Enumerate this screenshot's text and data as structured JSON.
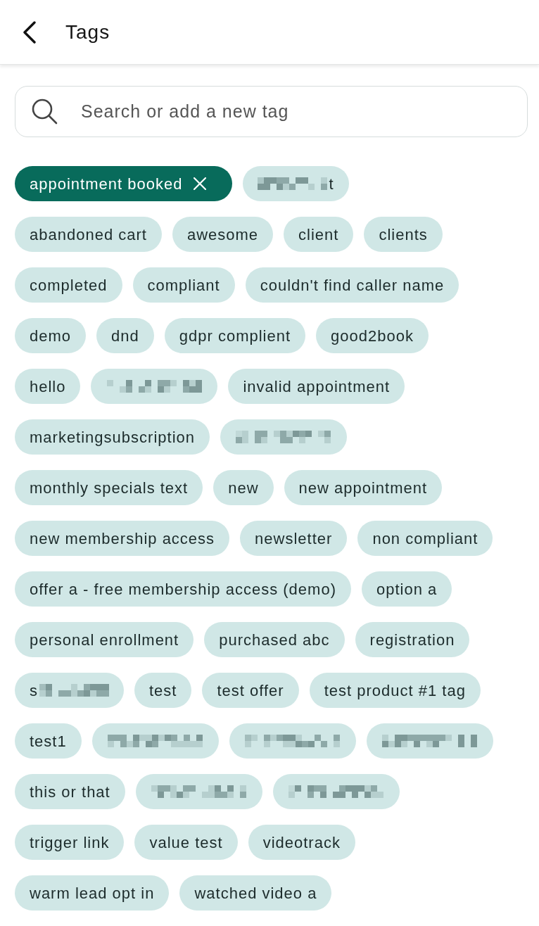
{
  "header": {
    "title": "Tags"
  },
  "search": {
    "placeholder": "Search or add a new tag"
  },
  "tags": [
    {
      "kind": "tag",
      "label": "appointment booked",
      "selected": true
    },
    {
      "kind": "redacted",
      "tail": "t",
      "selected": false
    },
    {
      "kind": "tag",
      "label": "abandoned cart",
      "selected": false
    },
    {
      "kind": "tag",
      "label": "awesome",
      "selected": false
    },
    {
      "kind": "tag",
      "label": "client",
      "selected": false
    },
    {
      "kind": "tag",
      "label": "clients",
      "selected": false
    },
    {
      "kind": "tag",
      "label": "completed",
      "selected": false
    },
    {
      "kind": "tag",
      "label": "compliant",
      "selected": false
    },
    {
      "kind": "tag",
      "label": "couldn't find caller name",
      "selected": false
    },
    {
      "kind": "tag",
      "label": "demo",
      "selected": false
    },
    {
      "kind": "tag",
      "label": "dnd",
      "selected": false
    },
    {
      "kind": "tag",
      "label": "gdpr complient",
      "selected": false
    },
    {
      "kind": "tag",
      "label": "good2book",
      "selected": false
    },
    {
      "kind": "tag",
      "label": "hello",
      "selected": false
    },
    {
      "kind": "redacted",
      "selected": false
    },
    {
      "kind": "tag",
      "label": "invalid appointment",
      "selected": false
    },
    {
      "kind": "tag",
      "label": "marketingsubscription",
      "selected": false
    },
    {
      "kind": "redacted",
      "selected": false
    },
    {
      "kind": "tag",
      "label": "monthly specials text",
      "selected": false
    },
    {
      "kind": "tag",
      "label": "new",
      "selected": false
    },
    {
      "kind": "tag",
      "label": "new appointment",
      "selected": false
    },
    {
      "kind": "tag",
      "label": "new membership access",
      "selected": false
    },
    {
      "kind": "tag",
      "label": "newsletter",
      "selected": false
    },
    {
      "kind": "tag",
      "label": "non compliant",
      "selected": false
    },
    {
      "kind": "tag",
      "label": "offer a - free membership access (demo)",
      "selected": false
    },
    {
      "kind": "tag",
      "label": "option a",
      "selected": false
    },
    {
      "kind": "tag",
      "label": "personal enrollment",
      "selected": false
    },
    {
      "kind": "tag",
      "label": "purchased abc",
      "selected": false
    },
    {
      "kind": "tag",
      "label": "registration",
      "selected": false
    },
    {
      "kind": "redacted",
      "head": "s",
      "selected": false
    },
    {
      "kind": "tag",
      "label": "test",
      "selected": false
    },
    {
      "kind": "tag",
      "label": "test offer",
      "selected": false
    },
    {
      "kind": "tag",
      "label": "test product #1 tag",
      "selected": false
    },
    {
      "kind": "tag",
      "label": "test1",
      "selected": false
    },
    {
      "kind": "redacted",
      "selected": false
    },
    {
      "kind": "redacted",
      "selected": false
    },
    {
      "kind": "redacted",
      "selected": false
    },
    {
      "kind": "tag",
      "label": "this or that",
      "selected": false
    },
    {
      "kind": "redacted",
      "selected": false
    },
    {
      "kind": "redacted",
      "selected": false
    },
    {
      "kind": "tag",
      "label": "trigger link",
      "selected": false
    },
    {
      "kind": "tag",
      "label": "value test",
      "selected": false
    },
    {
      "kind": "tag",
      "label": "videotrack",
      "selected": false
    },
    {
      "kind": "tag",
      "label": "warm lead opt in",
      "selected": false
    },
    {
      "kind": "tag",
      "label": "watched video a",
      "selected": false
    }
  ]
}
